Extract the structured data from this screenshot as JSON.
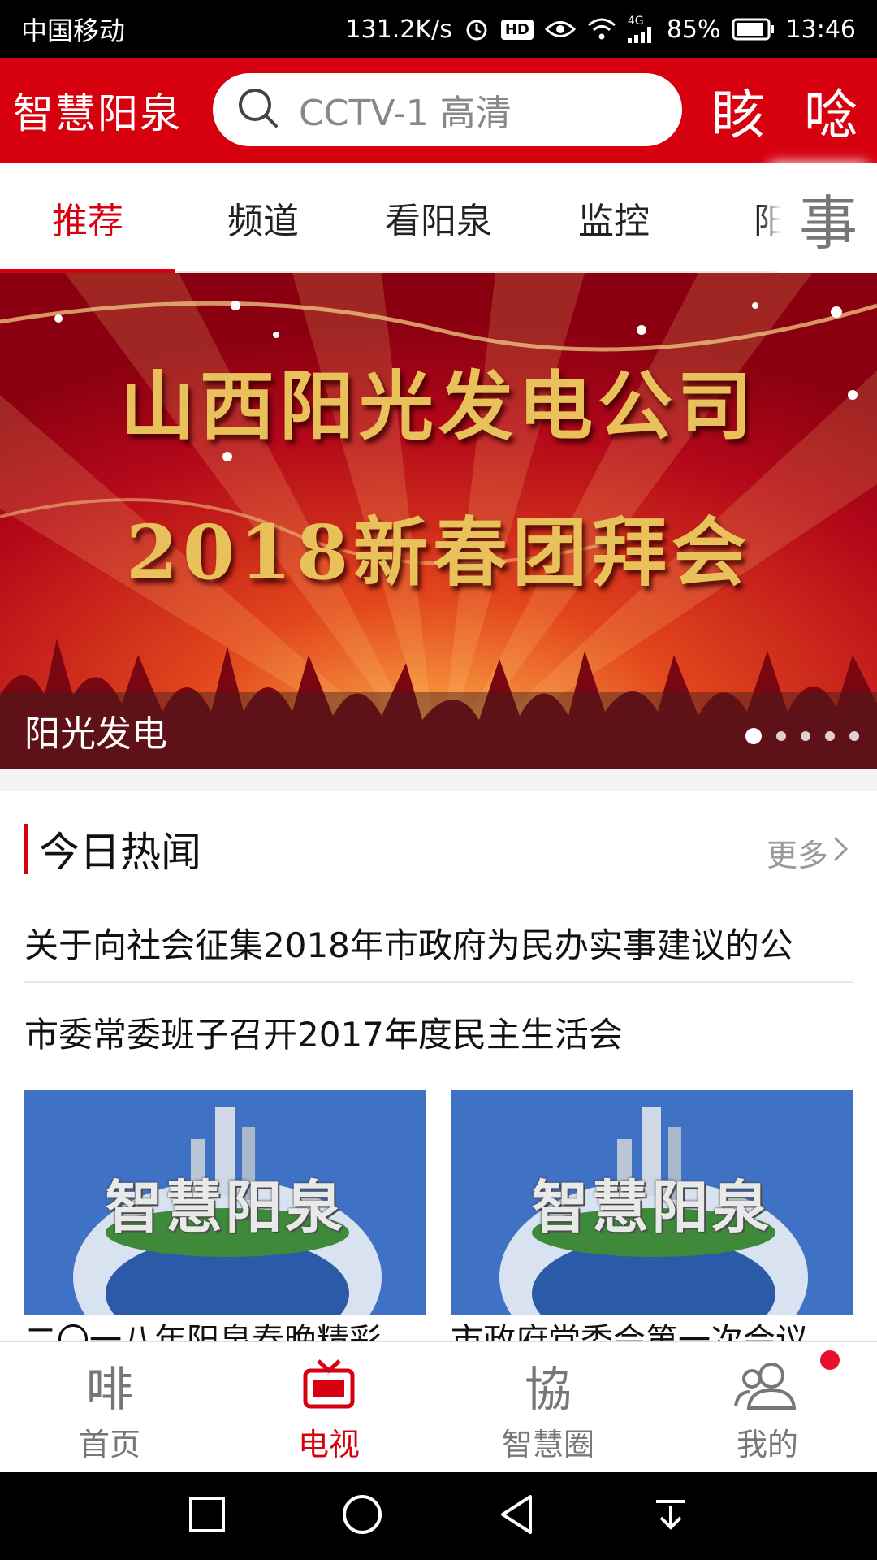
{
  "status_bar": {
    "carrier": "中国移动",
    "net_speed": "131.2K/s",
    "hd": "HD",
    "signal": "4G",
    "battery": "85%",
    "time": "13:46"
  },
  "header": {
    "brand": "智慧阳泉",
    "search_placeholder": "CCTV-1 高清",
    "btn1_glyph": "䀭",
    "btn2_glyph": "唸"
  },
  "tabs": {
    "items": [
      "推荐",
      "频道",
      "看阳泉",
      "监控",
      "阳泉"
    ],
    "more_glyph": "事",
    "active_index": 0
  },
  "banner": {
    "title": "山西阳光发电公司",
    "subtitle": "2018新春团拜会",
    "caption": "阳光发电",
    "slide_count": 5,
    "active_slide": 0
  },
  "section": {
    "title": "今日热闻",
    "more": "更多"
  },
  "news": [
    "关于向社会征集2018年市政府为民办实事建议的公",
    "市委常委班子召开2017年度民主生活会"
  ],
  "thumbs": [
    {
      "label": "智慧阳泉",
      "clipped_caption": "二〇一八年阳泉春晚精彩"
    },
    {
      "label": "智慧阳泉",
      "clipped_caption": "市政府党委会第一次会议"
    }
  ],
  "bottom_nav": {
    "items": [
      {
        "label": "首页",
        "glyph": "啡"
      },
      {
        "label": "电视",
        "glyph": "tv"
      },
      {
        "label": "智慧圈",
        "glyph": "協"
      },
      {
        "label": "我的",
        "glyph": "users"
      }
    ],
    "active_index": 1
  },
  "colors": {
    "brand_red": "#d7000f",
    "badge_red": "#e8102a"
  }
}
